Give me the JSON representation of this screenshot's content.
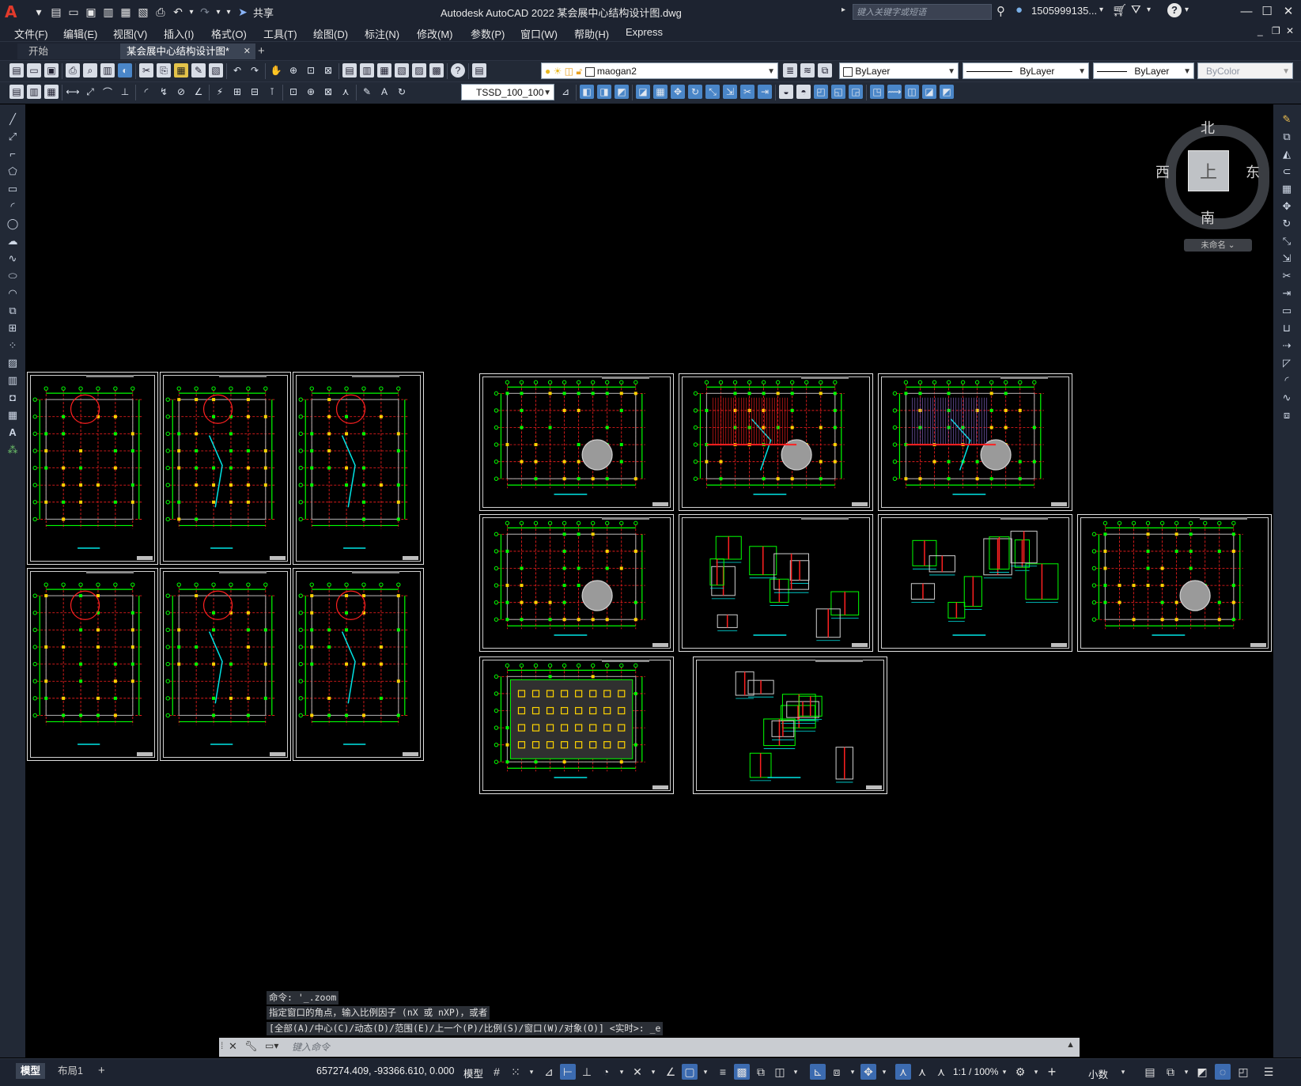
{
  "app": {
    "logo": "A",
    "title": "Autodesk AutoCAD 2022    某会展中心结构设计图.dwg",
    "share_label": "共享",
    "search_placeholder": "键入关键字或短语",
    "user": "1505999135...",
    "window_controls": [
      "minimize-icon",
      "maximize-icon",
      "close-icon"
    ]
  },
  "menus": [
    "文件(F)",
    "编辑(E)",
    "视图(V)",
    "插入(I)",
    "格式(O)",
    "工具(T)",
    "绘图(D)",
    "标注(N)",
    "修改(M)",
    "参数(P)",
    "窗口(W)",
    "帮助(H)",
    "Express"
  ],
  "tabs": {
    "start": "开始",
    "document": "某会展中心结构设计图*",
    "add": "+"
  },
  "properties": {
    "layer": "maogan2",
    "color": "ByLayer",
    "linetype": "ByLayer",
    "lineweight": "ByLayer",
    "plotstyle": "ByColor",
    "dimstyle": "TSSD_100_100"
  },
  "viewcube": {
    "north": "北",
    "south": "南",
    "east": "东",
    "west": "西",
    "face": "上",
    "wcs": "未命名"
  },
  "command": {
    "history": [
      "命令: '_.zoom",
      "指定窗口的角点，输入比例因子 (nX 或 nXP)，或者",
      "[全部(A)/中心(C)/动态(D)/范围(E)/上一个(P)/比例(S)/窗口(W)/对象(O)] <实时>: _e"
    ],
    "placeholder": "键入命令"
  },
  "status": {
    "model_tab": "模型",
    "layout_tab": "布局1",
    "add_tab": "+",
    "coordinates": "657274.409, -93366.610, 0.000",
    "mode": "模型",
    "scale": "1:1 / 100%",
    "units": "小数"
  },
  "colors": {
    "chrome": "#1d2330",
    "toolbar": "#222936",
    "canvas": "#000000",
    "cad_green": "#00ff00",
    "cad_red": "#ff2020",
    "cad_cyan": "#00e5e5",
    "accent_blue": "#3c6bb0"
  },
  "drawing_sheets": [
    {
      "name": "sheet-a1",
      "kind": "portrait-plan"
    },
    {
      "name": "sheet-a2",
      "kind": "portrait-plan"
    },
    {
      "name": "sheet-a3",
      "kind": "portrait-plan"
    },
    {
      "name": "sheet-a4",
      "kind": "portrait-plan"
    },
    {
      "name": "sheet-a5",
      "kind": "portrait-plan"
    },
    {
      "name": "sheet-a6",
      "kind": "portrait-plan"
    },
    {
      "name": "sheet-b1",
      "kind": "landscape-plan"
    },
    {
      "name": "sheet-b2",
      "kind": "landscape-plan"
    },
    {
      "name": "sheet-b3",
      "kind": "landscape-plan"
    },
    {
      "name": "sheet-b4",
      "kind": "landscape-plan"
    },
    {
      "name": "sheet-b5",
      "kind": "landscape-detail"
    },
    {
      "name": "sheet-b6",
      "kind": "landscape-detail"
    },
    {
      "name": "sheet-b7",
      "kind": "landscape-plan"
    },
    {
      "name": "sheet-b8",
      "kind": "landscape-plan"
    },
    {
      "name": "sheet-b9",
      "kind": "landscape-detail"
    }
  ]
}
